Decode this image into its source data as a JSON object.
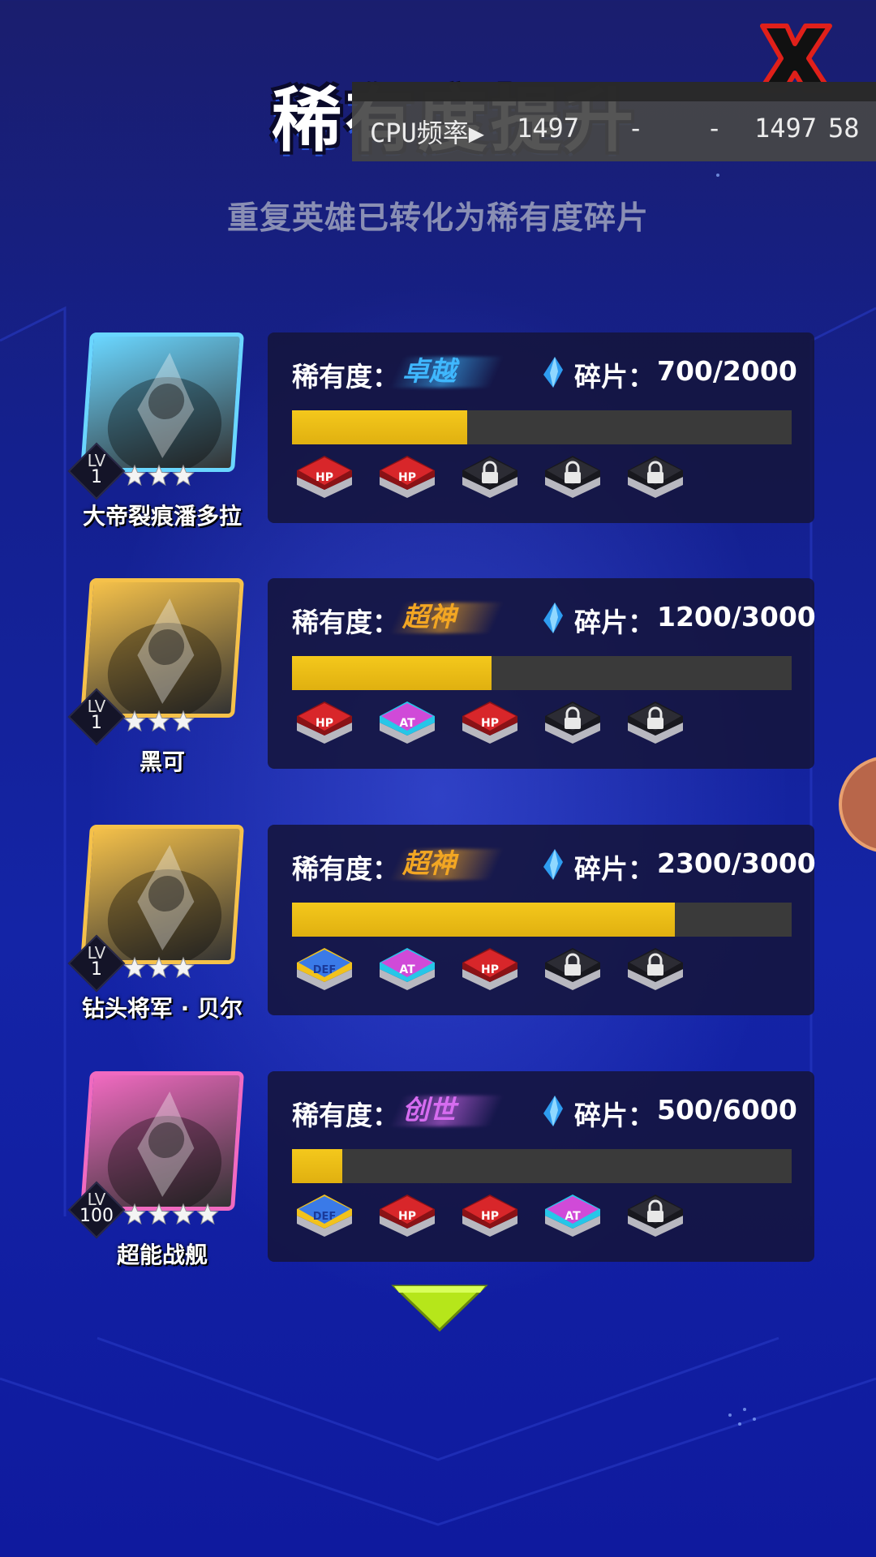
{
  "title": "稀有度提升",
  "subtitle": "重复英雄已转化为稀有度碎片",
  "cpu_overlay": {
    "label": "CPU频率▶",
    "v1": "1497",
    "v2": "-",
    "v3": "-",
    "v4": "1497",
    "v5": "58"
  },
  "rarity_label": "稀有度：",
  "fragment_label": "碎片：",
  "colors": {
    "bar_fill": "#f1c21a",
    "bar_empty": "#3a3a3a",
    "rarity_zhuoyue": "#3fb8ff",
    "rarity_chaoshen": "#f2a623",
    "rarity_chuangshi": "#d66cf0"
  },
  "heroes": [
    {
      "name": "大帝裂痕潘多拉",
      "lv_label": "LV",
      "level": "1",
      "stars": 3,
      "rarity": "卓越",
      "rarity_color": "#3fb8ff",
      "fragments": "700/2000",
      "progress": 0.35,
      "frame_color": "#6ad6ff",
      "chips": [
        "hp",
        "hp",
        "locked",
        "locked",
        "locked"
      ]
    },
    {
      "name": "黑可",
      "lv_label": "LV",
      "level": "1",
      "stars": 3,
      "rarity": "超神",
      "rarity_color": "#f2a623",
      "fragments": "1200/3000",
      "progress": 0.4,
      "frame_color": "#f5c14a",
      "chips": [
        "hp",
        "atk",
        "hp",
        "locked",
        "locked"
      ]
    },
    {
      "name": "钻头将军 · 贝尔",
      "lv_label": "LV",
      "level": "1",
      "stars": 3,
      "rarity": "超神",
      "rarity_color": "#f2a623",
      "fragments": "2300/3000",
      "progress": 0.766,
      "frame_color": "#f5c14a",
      "chips": [
        "def",
        "atk",
        "hp",
        "locked",
        "locked"
      ]
    },
    {
      "name": "超能战舰",
      "lv_label": "LV",
      "level": "100",
      "stars": 4,
      "rarity": "创世",
      "rarity_color": "#d66cf0",
      "fragments": "500/6000",
      "progress": 0.1,
      "frame_color": "#f06ac0",
      "chips": [
        "def",
        "hp",
        "hp",
        "atk",
        "locked"
      ]
    }
  ]
}
